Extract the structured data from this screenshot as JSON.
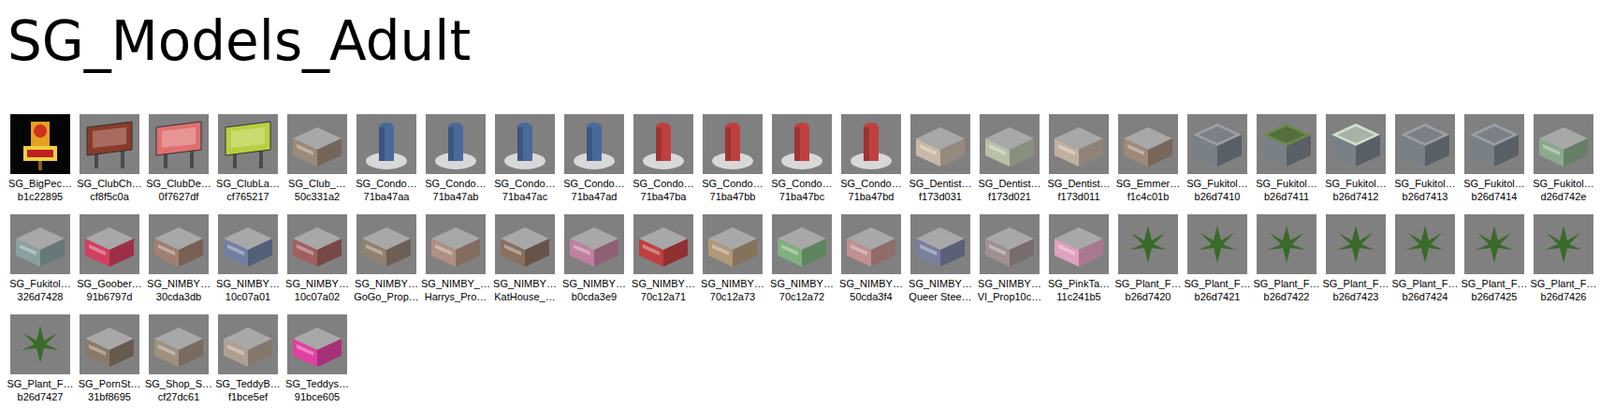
{
  "folder": {
    "title": "SG_Models_Adult",
    "items": [
      {
        "name": "SG_BigPec…",
        "subtitle": "b1c22895",
        "kind": "neon",
        "color": "#e8a020"
      },
      {
        "name": "SG_ClubCh…",
        "subtitle": "cf8f5c0a",
        "kind": "sign",
        "color": "#8b3a2a"
      },
      {
        "name": "SG_ClubDe…",
        "subtitle": "0f7627df",
        "kind": "sign",
        "color": "#e07070"
      },
      {
        "name": "SG_ClubLa…",
        "subtitle": "cf765217",
        "kind": "sign",
        "color": "#b8d040"
      },
      {
        "name": "SG_Club_…",
        "subtitle": "50c331a2",
        "kind": "building",
        "color": "#9a8a78"
      },
      {
        "name": "SG_Condo…",
        "subtitle": "71ba47aa",
        "kind": "condo",
        "color": "#4a6a9a"
      },
      {
        "name": "SG_Condo…",
        "subtitle": "71ba47ab",
        "kind": "condo",
        "color": "#4a6a9a"
      },
      {
        "name": "SG_Condo…",
        "subtitle": "71ba47ac",
        "kind": "condo",
        "color": "#4a6a9a"
      },
      {
        "name": "SG_Condo…",
        "subtitle": "71ba47ad",
        "kind": "condo",
        "color": "#4a6a9a"
      },
      {
        "name": "SG_Condo…",
        "subtitle": "71ba47ba",
        "kind": "condo",
        "color": "#c04040"
      },
      {
        "name": "SG_Condo…",
        "subtitle": "71ba47bb",
        "kind": "condo",
        "color": "#c04040"
      },
      {
        "name": "SG_Condo…",
        "subtitle": "71ba47bc",
        "kind": "condo",
        "color": "#c04040"
      },
      {
        "name": "SG_Condo…",
        "subtitle": "71ba47bd",
        "kind": "condo",
        "color": "#c04040"
      },
      {
        "name": "SG_Dentist…",
        "subtitle": "f173d031",
        "kind": "building",
        "color": "#c8b8a8"
      },
      {
        "name": "SG_Dentist…",
        "subtitle": "f173d021",
        "kind": "building",
        "color": "#b8c0a8"
      },
      {
        "name": "SG_Dentist…",
        "subtitle": "f173d011",
        "kind": "building",
        "color": "#c0b0a0"
      },
      {
        "name": "SG_Emmer…",
        "subtitle": "f1c4c01b",
        "kind": "building",
        "color": "#a08878"
      },
      {
        "name": "SG_Fukitol…",
        "subtitle": "b26d7410",
        "kind": "tank",
        "color": "#9aa0a8"
      },
      {
        "name": "SG_Fukitol…",
        "subtitle": "b26d7411",
        "kind": "tank",
        "color": "#6a8a4a"
      },
      {
        "name": "SG_Fukitol…",
        "subtitle": "b26d7412",
        "kind": "tank",
        "color": "#d0e0d0"
      },
      {
        "name": "SG_Fukitol…",
        "subtitle": "b26d7413",
        "kind": "tank",
        "color": "#9aa0a8"
      },
      {
        "name": "SG_Fukitol…",
        "subtitle": "b26d7414",
        "kind": "tank",
        "color": "#9aa0a8"
      },
      {
        "name": "SG_Fukitol…",
        "subtitle": "d26d742e",
        "kind": "building",
        "color": "#8aaa8a"
      },
      {
        "name": "SG_Fukitol…",
        "subtitle": "326d7428",
        "kind": "building",
        "color": "#8aa0a0"
      },
      {
        "name": "SG_Goober…",
        "subtitle": "91b6797d",
        "kind": "building",
        "color": "#d04060"
      },
      {
        "name": "SG_NIMBY…",
        "subtitle": "30cda3db",
        "kind": "building",
        "color": "#a08070"
      },
      {
        "name": "SG_NIMBY…",
        "subtitle": "10c07a01",
        "kind": "building",
        "color": "#7080a0"
      },
      {
        "name": "SG_NIMBY…",
        "subtitle": "10c07a02",
        "kind": "building",
        "color": "#a06060"
      },
      {
        "name": "SG_NIMBY…",
        "subtitle": "GoGo_Prop…",
        "kind": "building",
        "color": "#908070"
      },
      {
        "name": "SG_NIMBY_…",
        "subtitle": "Harrys_Pro…",
        "kind": "building",
        "color": "#b09080"
      },
      {
        "name": "SG_NIMBY…",
        "subtitle": "KatHouse_…",
        "kind": "building",
        "color": "#8a7060"
      },
      {
        "name": "SG_NIMBY…",
        "subtitle": "b0cda3e9",
        "kind": "building",
        "color": "#c080a0"
      },
      {
        "name": "SG_NIMBY…",
        "subtitle": "70c12a71",
        "kind": "building",
        "color": "#c04040"
      },
      {
        "name": "SG_NIMBY…",
        "subtitle": "70c12a73",
        "kind": "building",
        "color": "#b09878"
      },
      {
        "name": "SG_NIMBY…",
        "subtitle": "70c12a72",
        "kind": "building",
        "color": "#80b080"
      },
      {
        "name": "SG_NIMBY…",
        "subtitle": "50cda3f4",
        "kind": "building",
        "color": "#c09090"
      },
      {
        "name": "SG_NIMBY…",
        "subtitle": "Queer Stee…",
        "kind": "building",
        "color": "#7880a0"
      },
      {
        "name": "SG_NIMBY…",
        "subtitle": "VI_Prop10c…",
        "kind": "building",
        "color": "#a09090"
      },
      {
        "name": "SG_PinkTa…",
        "subtitle": "11c241b5",
        "kind": "building",
        "color": "#e0a0c0"
      },
      {
        "name": "SG_Plant_F…",
        "subtitle": "b26d7420",
        "kind": "plant",
        "color": "#3a6a2a"
      },
      {
        "name": "SG_Plant_F…",
        "subtitle": "b26d7421",
        "kind": "plant",
        "color": "#3a6a2a"
      },
      {
        "name": "SG_Plant_F…",
        "subtitle": "b26d7422",
        "kind": "plant",
        "color": "#3a6a2a"
      },
      {
        "name": "SG_Plant_F…",
        "subtitle": "b26d7423",
        "kind": "plant",
        "color": "#3a6a2a"
      },
      {
        "name": "SG_Plant_F…",
        "subtitle": "b26d7424",
        "kind": "plant",
        "color": "#3a6a2a"
      },
      {
        "name": "SG_Plant_F…",
        "subtitle": "b26d7425",
        "kind": "plant",
        "color": "#3a6a2a"
      },
      {
        "name": "SG_Plant_F…",
        "subtitle": "b26d7426",
        "kind": "plant",
        "color": "#3a6a2a"
      },
      {
        "name": "SG_Plant_F…",
        "subtitle": "b26d7427",
        "kind": "plant",
        "color": "#3a6a2a"
      },
      {
        "name": "SG_PornSt…",
        "subtitle": "31bf8695",
        "kind": "building",
        "color": "#8a7a6a"
      },
      {
        "name": "SG_Shop_S…",
        "subtitle": "cf27dc61",
        "kind": "building",
        "color": "#a09080"
      },
      {
        "name": "SG_TeddyB…",
        "subtitle": "f1bce5ef",
        "kind": "building",
        "color": "#b0a090"
      },
      {
        "name": "SG_Teddys…",
        "subtitle": "91bce605",
        "kind": "building",
        "color": "#e040a0"
      }
    ]
  }
}
